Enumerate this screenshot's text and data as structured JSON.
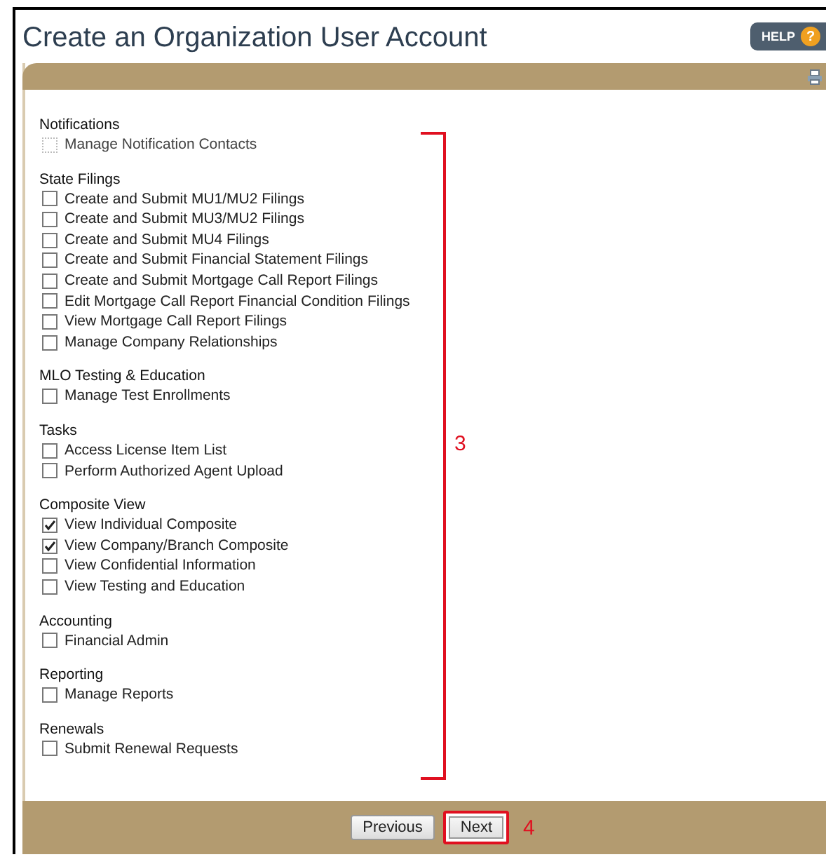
{
  "page": {
    "title": "Create an Organization User Account",
    "help_button": "HELP",
    "help_badge": "?"
  },
  "groups": [
    {
      "title": "Notifications",
      "items": [
        {
          "label": "Manage Notification Contacts",
          "checked": false,
          "disabled": true
        }
      ]
    },
    {
      "title": "State Filings",
      "items": [
        {
          "label": "Create and Submit MU1/MU2 Filings",
          "checked": false,
          "disabled": false
        },
        {
          "label": "Create and Submit MU3/MU2 Filings",
          "checked": false,
          "disabled": false
        },
        {
          "label": "Create and Submit MU4 Filings",
          "checked": false,
          "disabled": false
        },
        {
          "label": "Create and Submit Financial Statement Filings",
          "checked": false,
          "disabled": false
        },
        {
          "label": "Create and Submit Mortgage Call Report Filings",
          "checked": false,
          "disabled": false
        },
        {
          "label": "Edit Mortgage Call Report Financial Condition Filings",
          "checked": false,
          "disabled": false
        },
        {
          "label": "View Mortgage Call Report Filings",
          "checked": false,
          "disabled": false
        },
        {
          "label": "Manage Company Relationships",
          "checked": false,
          "disabled": false
        }
      ]
    },
    {
      "title": "MLO Testing & Education",
      "items": [
        {
          "label": "Manage Test Enrollments",
          "checked": false,
          "disabled": false
        }
      ]
    },
    {
      "title": "Tasks",
      "items": [
        {
          "label": "Access License Item List",
          "checked": false,
          "disabled": false
        },
        {
          "label": "Perform Authorized Agent Upload",
          "checked": false,
          "disabled": false
        }
      ]
    },
    {
      "title": "Composite View",
      "items": [
        {
          "label": "View Individual Composite",
          "checked": true,
          "disabled": false
        },
        {
          "label": "View Company/Branch Composite",
          "checked": true,
          "disabled": false
        },
        {
          "label": "View Confidential Information",
          "checked": false,
          "disabled": false
        },
        {
          "label": "View Testing and Education",
          "checked": false,
          "disabled": false
        }
      ]
    },
    {
      "title": "Accounting",
      "items": [
        {
          "label": "Financial Admin",
          "checked": false,
          "disabled": false
        }
      ]
    },
    {
      "title": "Reporting",
      "items": [
        {
          "label": "Manage Reports",
          "checked": false,
          "disabled": false
        }
      ]
    },
    {
      "title": "Renewals",
      "items": [
        {
          "label": "Submit Renewal Requests",
          "checked": false,
          "disabled": false
        }
      ]
    }
  ],
  "list_annotation": "3",
  "buttons": [
    {
      "label": "Previous",
      "highlighted": false
    },
    {
      "label": "Next",
      "highlighted": true,
      "annotation": "4"
    }
  ]
}
